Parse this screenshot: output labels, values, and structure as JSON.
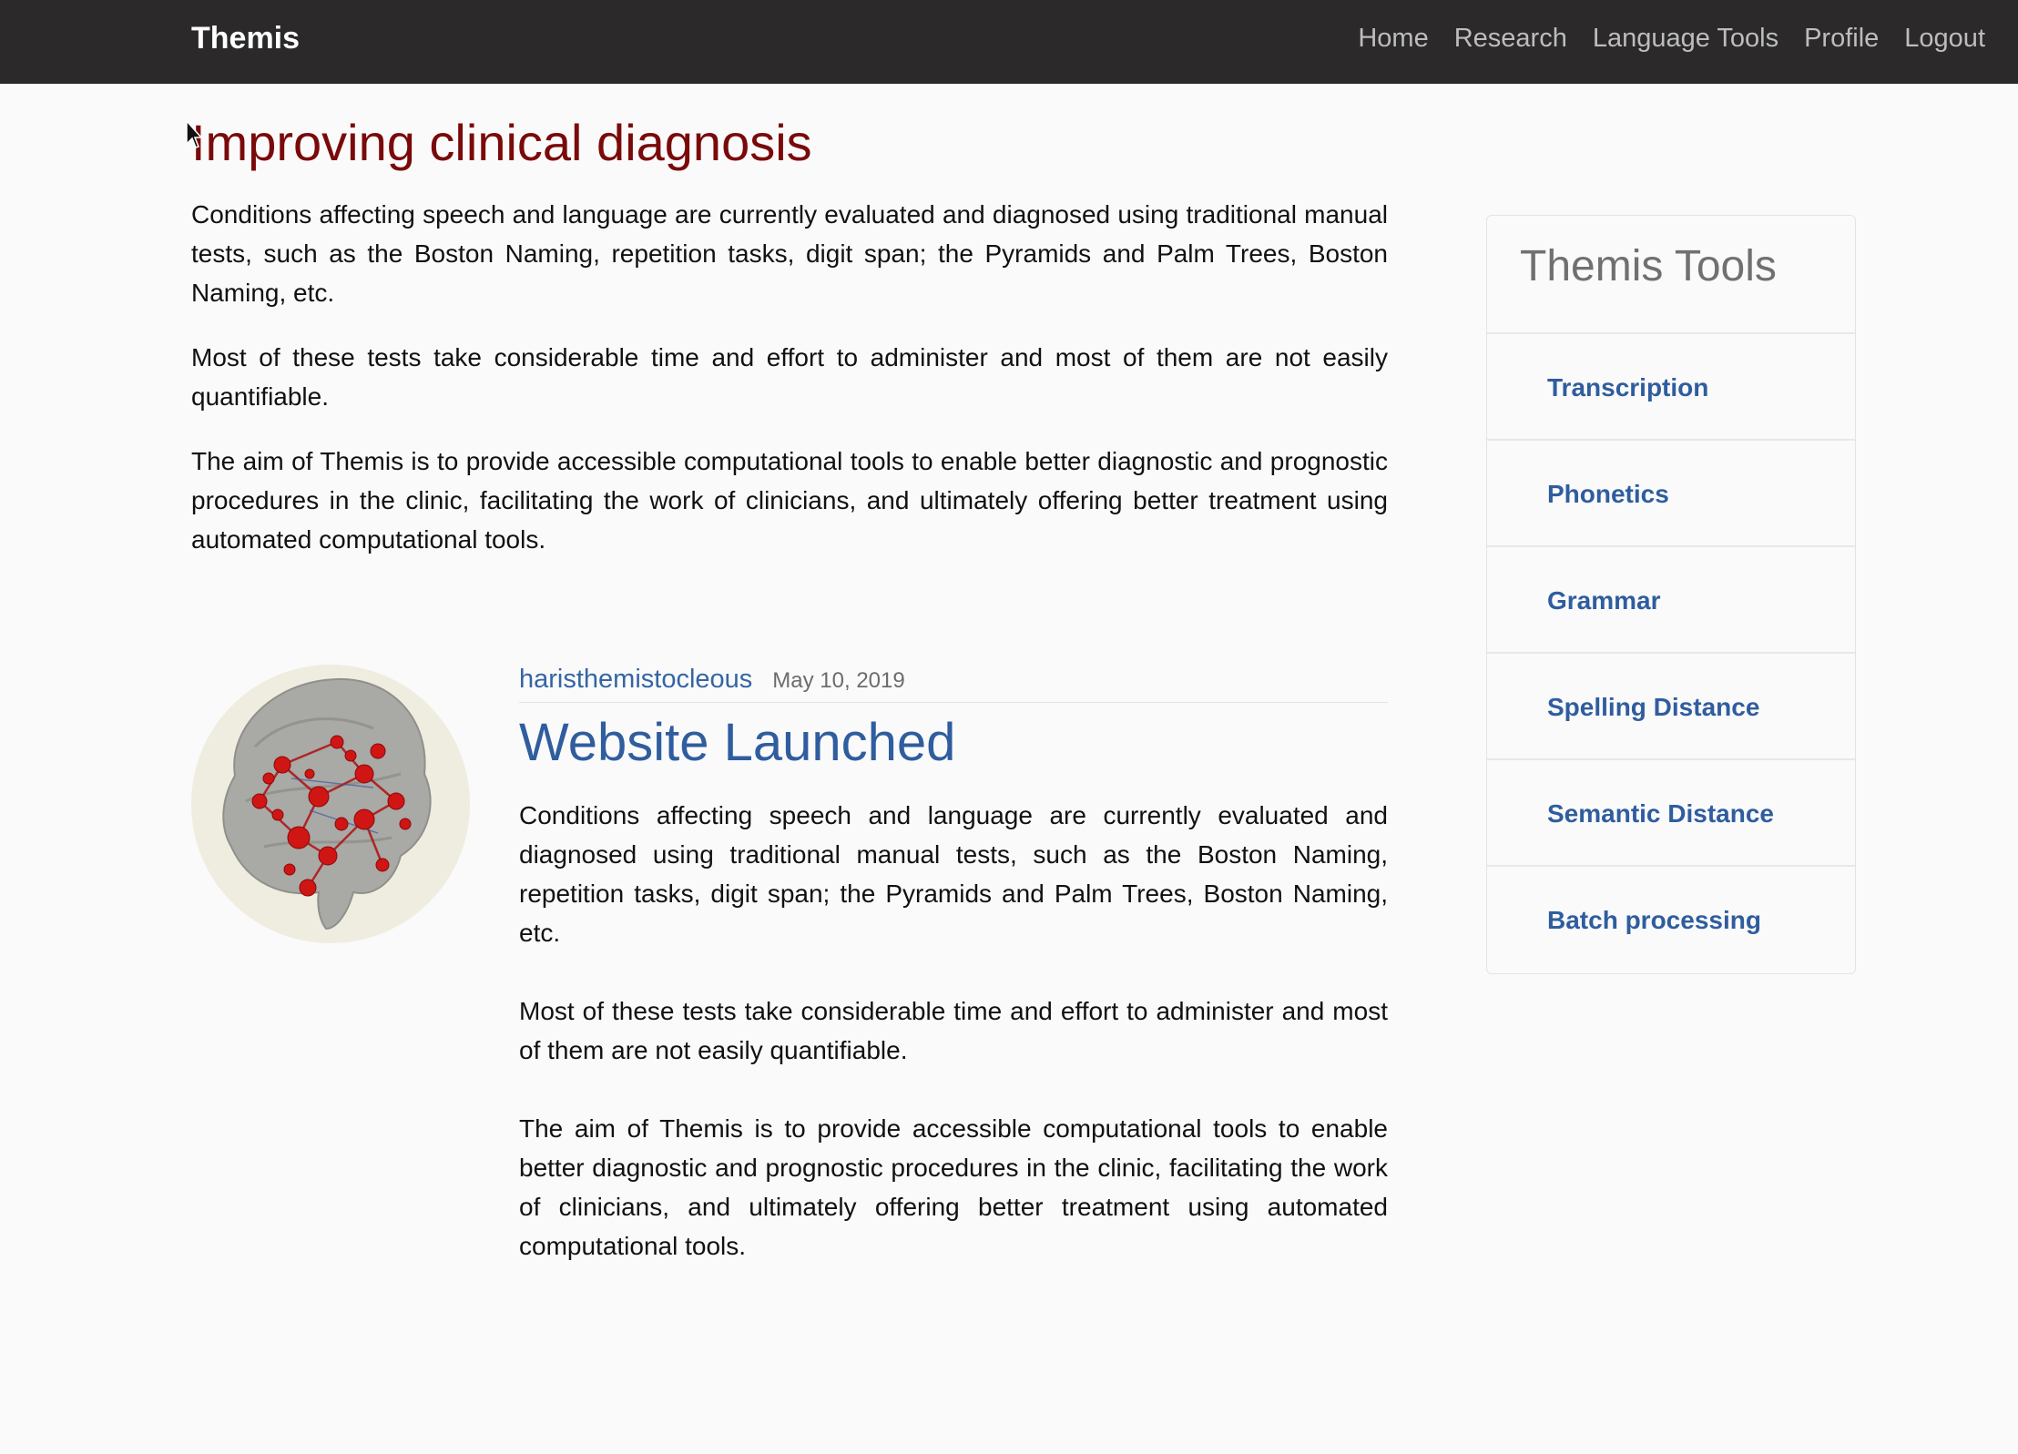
{
  "navbar": {
    "brand": "Themis",
    "links": [
      "Home",
      "Research",
      "Language Tools",
      "Profile",
      "Logout"
    ]
  },
  "main": {
    "title": "Improving clinical diagnosis",
    "paragraphs": [
      "Conditions affecting speech and language are currently evaluated and diagnosed using traditional manual tests, such as the Boston Naming, repetition tasks, digit span; the Pyramids and Palm Trees, Boston Naming, etc.",
      "Most of these tests take considerable time and effort to administer and most of them are not easily quantifiable.",
      "The aim of Themis is to provide accessible computational tools to enable better diagnostic and prognostic procedures in the clinic, facilitating the work of clinicians, and ultimately offering better treatment using automated computational tools."
    ]
  },
  "post": {
    "author": "haristhemistocleous",
    "date": "May 10, 2019",
    "title": "Website Launched",
    "paragraphs": [
      "Conditions affecting speech and language are currently evaluated and diagnosed using traditional manual tests, such as the Boston Naming, repetition tasks, digit span; the Pyramids and Palm Trees, Boston Naming, etc.",
      "Most of these tests take considerable time and effort to administer and most of them are not easily quantifiable.",
      "The aim of Themis is to provide accessible computational tools to enable better diagnostic and prognostic procedures in the clinic, facilitating the work of clinicians, and ultimately offering better treatment using automated computational tools."
    ]
  },
  "sidebar": {
    "title": "Themis Tools",
    "items": [
      "Transcription",
      "Phonetics",
      "Grammar",
      "Spelling Distance",
      "Semantic Distance",
      "Batch processing"
    ]
  },
  "colors": {
    "navbar_bg": "#2b2929",
    "title_red": "#7a0a0a",
    "link_blue": "#2f5d9e"
  }
}
